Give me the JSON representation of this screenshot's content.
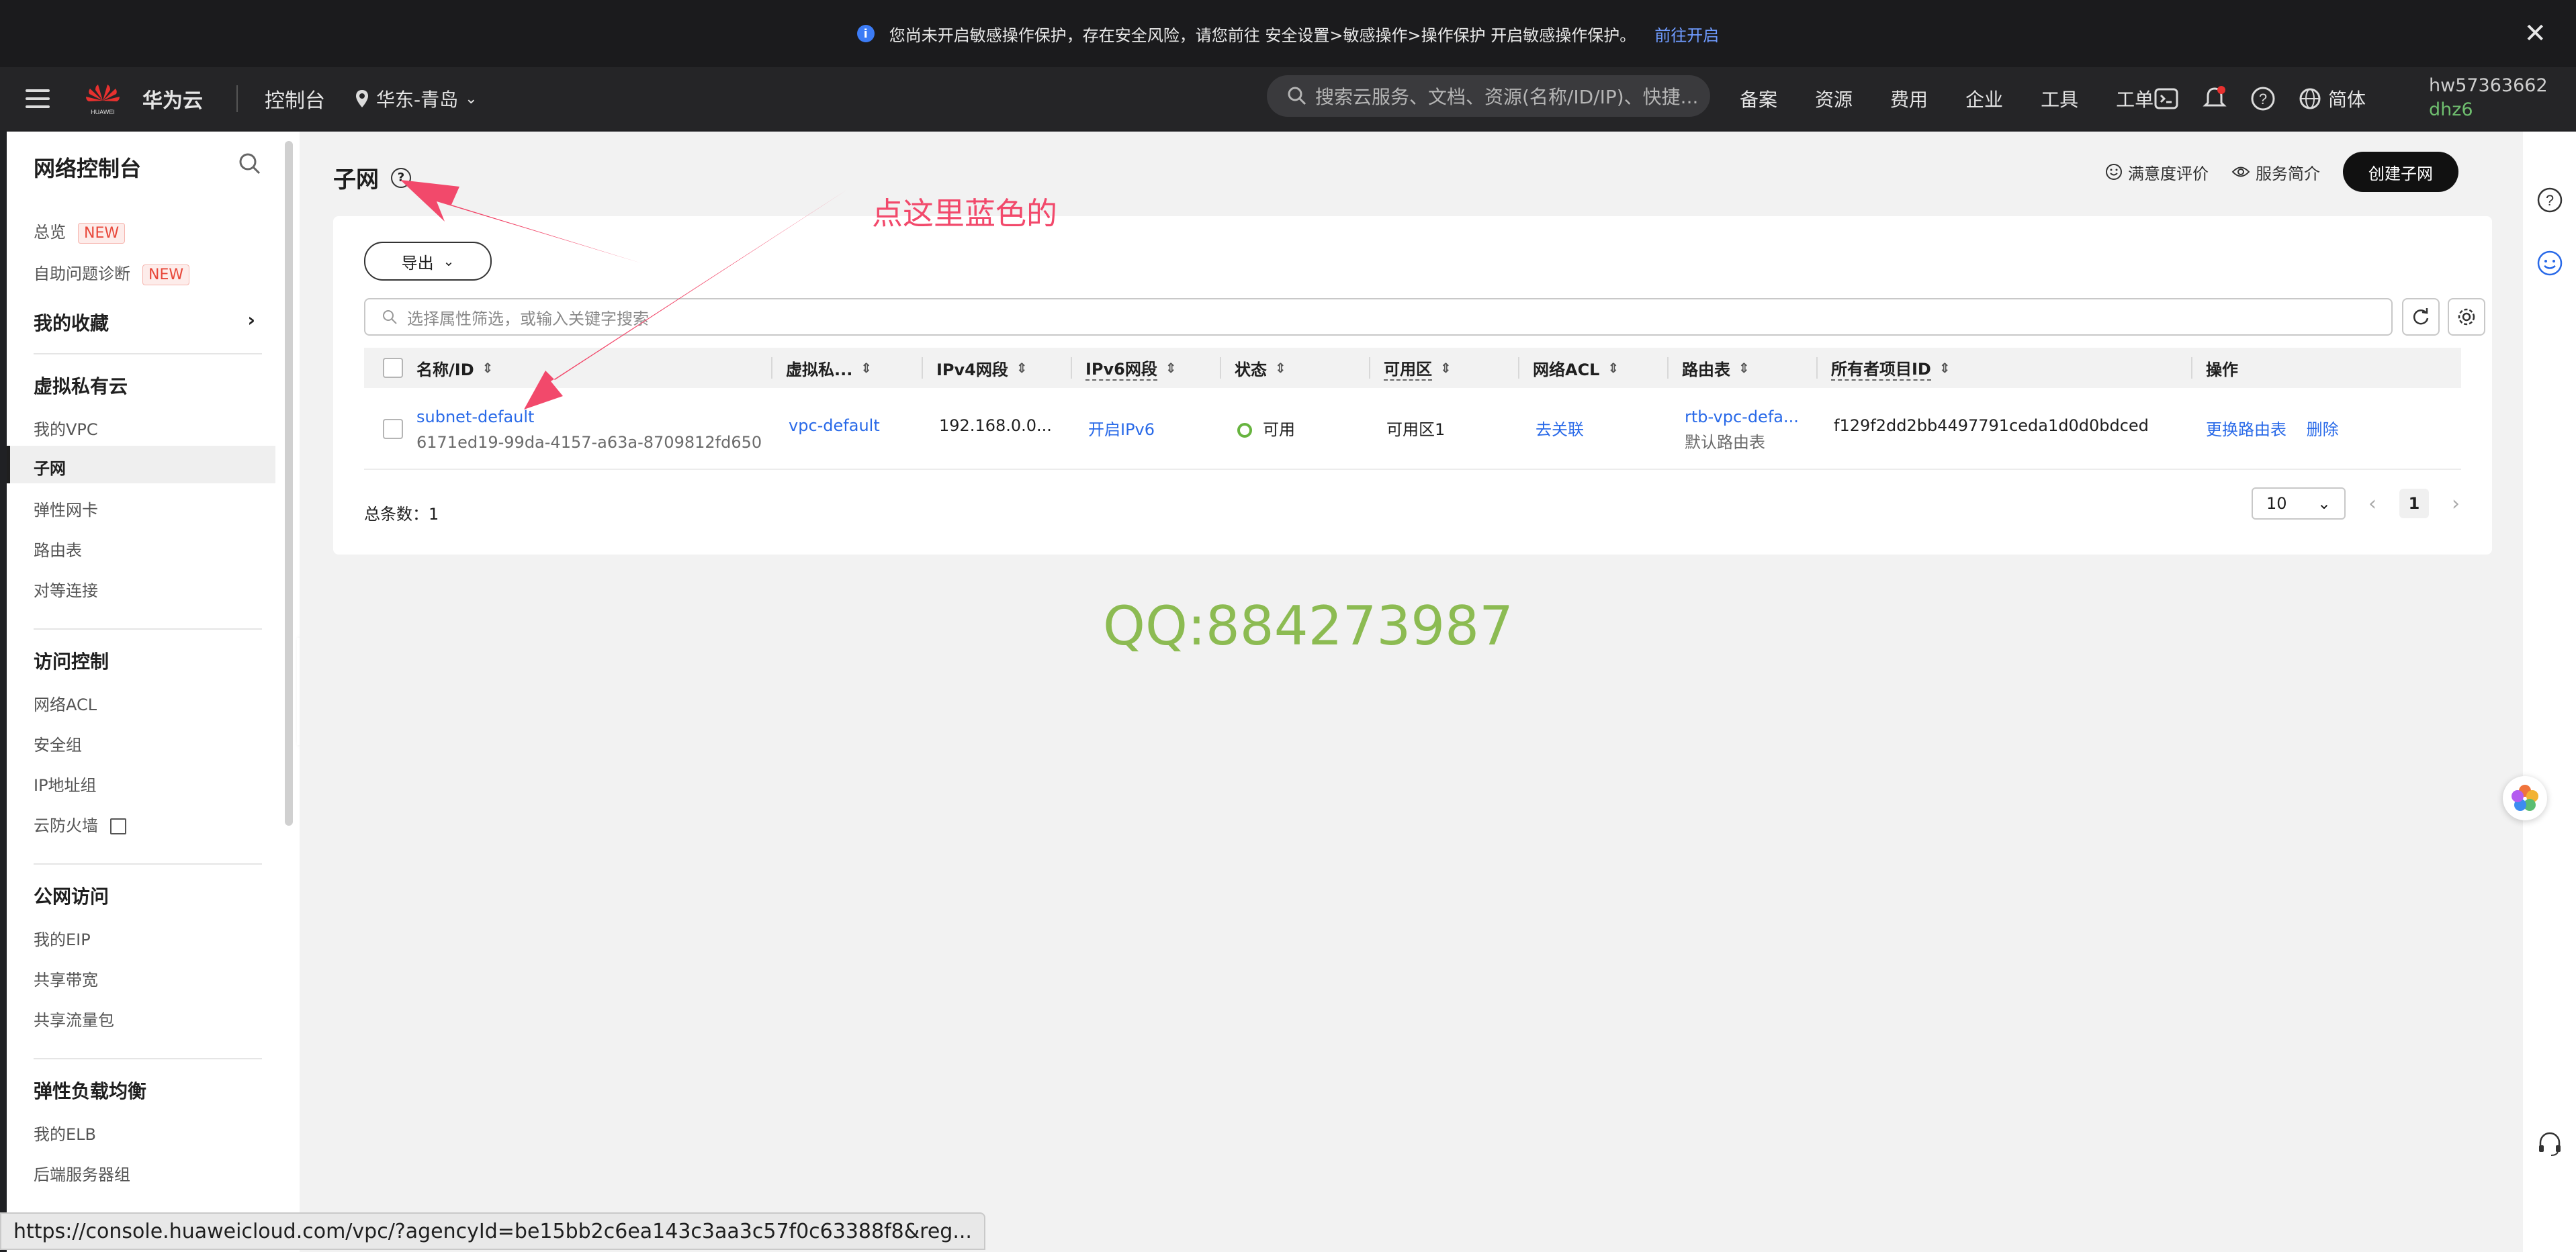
{
  "notice": {
    "text": "您尚未开启敏感操作保护，存在安全风险，请您前往 安全设置>敏感操作>操作保护 开启敏感操作保护。",
    "link": "前往开启"
  },
  "topnav": {
    "brand": "华为云",
    "logo_text": "HUAWEI",
    "console": "控制台",
    "region": "华东-青岛",
    "search_placeholder": "搜索云服务、文档、资源(名称/ID/IP)、快捷...",
    "links": [
      "备案",
      "资源",
      "费用",
      "企业",
      "工具",
      "工单"
    ],
    "lang": "简体",
    "user_line1": "hw57363662",
    "user_line2": "dhz6"
  },
  "sidebar": {
    "title": "网络控制台",
    "overview": "总览",
    "overview_badge": "NEW",
    "diagnose": "自助问题诊断",
    "diagnose_badge": "NEW",
    "favorites": "我的收藏",
    "vpc_group": "虚拟私有云",
    "my_vpc": "我的VPC",
    "subnet": "子网",
    "eni": "弹性网卡",
    "route_table": "路由表",
    "peering": "对等连接",
    "access_group": "访问控制",
    "acl": "网络ACL",
    "security_group": "安全组",
    "ip_group": "IP地址组",
    "firewall": "云防火墙",
    "public_group": "公网访问",
    "my_eip": "我的EIP",
    "bandwidth": "共享带宽",
    "traffic": "共享流量包",
    "elb_group": "弹性负载均衡",
    "my_elb": "我的ELB",
    "backend": "后端服务器组"
  },
  "main": {
    "title": "子网",
    "feedback": "满意度评价",
    "intro": "服务简介",
    "create": "创建子网",
    "export": "导出",
    "filter_placeholder": "选择属性筛选，或输入关键字搜索",
    "columns": {
      "name": "名称/ID",
      "vpc": "虚拟私...",
      "ipv4": "IPv4网段",
      "ipv6": "IPv6网段",
      "status": "状态",
      "az": "可用区",
      "acl": "网络ACL",
      "route": "路由表",
      "owner": "所有者项目ID",
      "ops": "操作"
    },
    "row": {
      "name": "subnet-default",
      "id": "6171ed19-99da-4157-a63a-8709812fd650",
      "vpc": "vpc-default",
      "ipv4": "192.168.0.0...",
      "ipv6": "开启IPv6",
      "status": "可用",
      "az": "可用区1",
      "acl": "去关联",
      "route": "rtb-vpc-defa...",
      "route_sub": "默认路由表",
      "owner": "f129f2dd2bb4497791ceda1d0d0bdced",
      "op1": "更换路由表",
      "op2": "删除"
    },
    "total_label": "总条数：",
    "total": "1",
    "page_size": "10",
    "page": "1"
  },
  "annotation": "点这里蓝色的",
  "watermark": "QQ:884273987",
  "status_url": "https://console.huaweicloud.com/vpc/?agencyId=be15bb2c6ea143c3aa3c57f0c63388f8&reg...",
  "colors": {
    "accent_blue": "#2869e8",
    "annotation_red": "#f2496b",
    "watermark_green": "#8cbb52",
    "status_green": "#67b43f"
  }
}
